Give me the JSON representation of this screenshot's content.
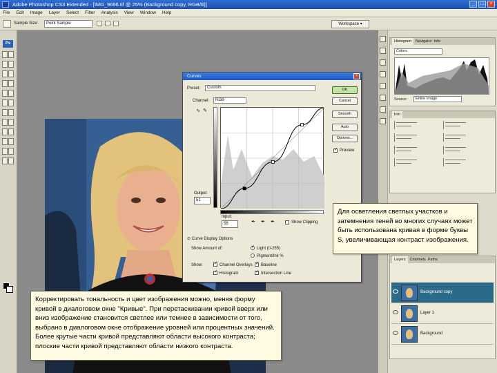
{
  "window": {
    "title": "Adobe Photoshop CS3 Extended - [IMG_9696.tif @ 25% (Background copy, RGB/8)]",
    "minimize": "_",
    "maximize": "□",
    "close": "×"
  },
  "menu": [
    "File",
    "Edit",
    "Image",
    "Layer",
    "Select",
    "Filter",
    "Analysis",
    "View",
    "Window",
    "Help"
  ],
  "options_bar": {
    "sample_label": "Sample Size:",
    "sample_value": "Point Sample",
    "workspace_label": "Workspace ▾"
  },
  "tools": {
    "logo": "Ps"
  },
  "curves_dialog": {
    "title": "Curves",
    "close": "×",
    "preset_label": "Preset:",
    "preset_value": "Custom",
    "channel_label": "Channel:",
    "channel_value": "RGB",
    "output_label": "Output:",
    "output_value": "51",
    "input_label": "Input:",
    "input_value": "58",
    "buttons": [
      "OK",
      "Cancel",
      "Smooth",
      "Auto",
      "Options..."
    ],
    "preview_label": "Preview",
    "show_clipping_label": "Show Clipping",
    "display_options_label": "Curve Display Options",
    "show_amount_label": "Show Amount of:",
    "light_label": "Light (0-255)",
    "pigment_label": "Pigment/Ink %",
    "show_label": "Show:",
    "channel_overlays_label": "Channel Overlays",
    "baseline_label": "Baseline",
    "histogram_label": "Histogram",
    "intersection_label": "Intersection Line"
  },
  "dock": {
    "histogram_tabs": [
      "Histogram",
      "Navigator",
      "Info"
    ],
    "histogram_channel": "Colors",
    "source_label": "Source:",
    "source_value": "Entire Image",
    "info_tabs": [
      "Info"
    ],
    "layers_tabs": [
      "Layers",
      "Channels",
      "Paths"
    ],
    "layers": [
      {
        "name": "Background copy",
        "active": true
      },
      {
        "name": "Layer 1",
        "active": false
      },
      {
        "name": "Background",
        "active": false
      }
    ]
  },
  "callouts": {
    "right": "Для осветления светлых участков и затемнения теней во многих случаях может быть использована кривая в форме буквы S, увеличивающая контраст изображения.",
    "left": "Корректировать тональность и цвет изображения можно, меняя форму кривой в диалоговом окне \"Кривые\". При перетаскивании кривой вверх или вниз изображение становится светлее или темнее в зависимости от того, выбрано в диалоговом окне отображение уровней или процентных значений. Более крутые части кривой представляют области высокого контраста; плоские части кривой представляют области низкого контраста."
  },
  "colors": {
    "titlebar": "#1f58c3",
    "active_layer": "#2c6a8a",
    "callout_bg": "#fffbe2"
  },
  "chart_data": {
    "type": "line",
    "series": [
      {
        "values": [
          [
            0,
            0
          ],
          [
            58,
            51
          ],
          [
            128,
            118
          ],
          [
            200,
            212
          ],
          [
            255,
            255
          ]
        ]
      }
    ],
    "xlim": [
      0,
      255
    ],
    "ylim": [
      0,
      255
    ],
    "grid": true
  }
}
